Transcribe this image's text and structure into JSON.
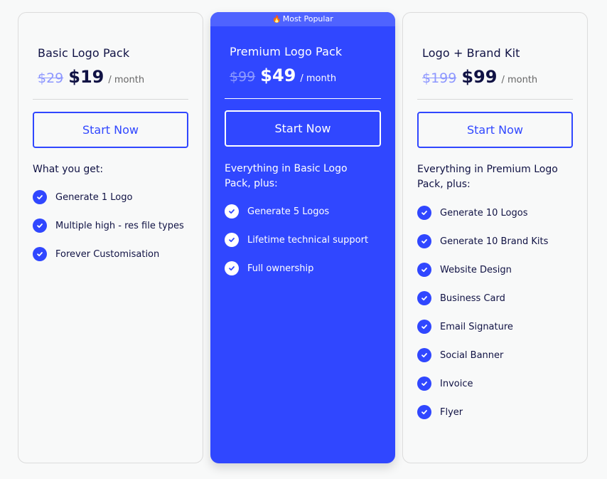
{
  "plans": [
    {
      "title": "Basic Logo Pack",
      "old_price": "$29",
      "price": "$19",
      "period": "/ month",
      "cta_label": "Start Now",
      "features_heading": "What you get:",
      "features": [
        "Generate 1 Logo",
        "Multiple high - res file types",
        "Forever Customisation"
      ]
    },
    {
      "badge": "Most Popular",
      "badge_icon": "fire-icon",
      "title": "Premium Logo Pack",
      "old_price": "$99",
      "price": "$49",
      "period": "/ month",
      "cta_label": "Start Now",
      "features_heading": "Everything in Basic Logo Pack, plus:",
      "features": [
        "Generate 5 Logos",
        "Lifetime technical support",
        "Full ownership"
      ]
    },
    {
      "title": "Logo + Brand Kit",
      "old_price": "$199",
      "price": "$99",
      "period": "/ month",
      "cta_label": "Start Now",
      "features_heading": "Everything in Premium Logo Pack, plus:",
      "features": [
        "Generate 10 Logos",
        "Generate 10 Brand Kits",
        "Website Design",
        "Business Card",
        "Email Signature",
        "Social Banner",
        "Invoice",
        "Flyer"
      ]
    }
  ],
  "colors": {
    "accent": "#3047ff",
    "badge": "#4f63ff",
    "text": "#101244",
    "strike": "#8d97ff"
  },
  "icons": {
    "check": "check-circle-icon",
    "fire": "fire-icon"
  }
}
